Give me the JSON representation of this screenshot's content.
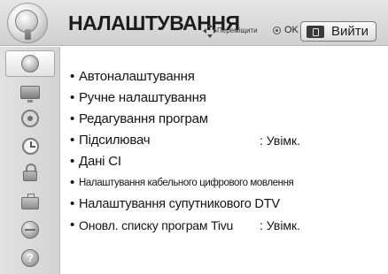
{
  "header": {
    "title": "НАЛАШТУВАННЯ",
    "nav_move": "Переміщити",
    "nav_ok": "OK",
    "exit_label": "Вийти",
    "icons": {
      "section": "satellite-dish-icon",
      "navigation": "four-way-arrows-icon",
      "ok": "ok-circle-icon",
      "exit": "exit-key-icon"
    }
  },
  "sidebar": {
    "items": [
      {
        "name": "sidebar-item-setup",
        "icon": "satellite-icon",
        "active": true
      },
      {
        "name": "sidebar-item-picture",
        "icon": "tv-icon",
        "active": false
      },
      {
        "name": "sidebar-item-audio",
        "icon": "speaker-icon",
        "active": false
      },
      {
        "name": "sidebar-item-time",
        "icon": "clock-icon",
        "active": false
      },
      {
        "name": "sidebar-item-lock",
        "icon": "lock-icon",
        "active": false
      },
      {
        "name": "sidebar-item-option",
        "icon": "briefcase-icon",
        "active": false
      },
      {
        "name": "sidebar-item-network",
        "icon": "globe-icon",
        "active": false
      },
      {
        "name": "sidebar-item-support",
        "icon": "help-icon",
        "active": false
      }
    ]
  },
  "menu": {
    "bullet": "•",
    "items": [
      {
        "label": "Автоналаштування",
        "value": ""
      },
      {
        "label": "Ручне налаштування",
        "value": ""
      },
      {
        "label": "Редагування програм",
        "value": ""
      },
      {
        "label": "Підсилювач",
        "value": ": Увімк."
      },
      {
        "label": "Дані CI",
        "value": ""
      },
      {
        "label": "Налаштування кабельного цифрового мовлення",
        "value": ""
      },
      {
        "label": "Налаштування супутникового DTV",
        "value": ""
      },
      {
        "label": "Оновл. списку програм Tivu",
        "value": ": Увімк."
      }
    ]
  },
  "colors": {
    "header_bg": "#d9d9d9",
    "sidebar_bg": "#dadada",
    "text": "#141414"
  }
}
